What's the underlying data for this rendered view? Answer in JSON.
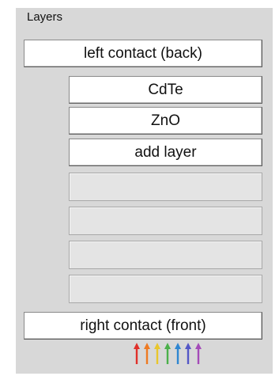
{
  "panel": {
    "title": "Layers",
    "left_contact_label": "left contact (back)",
    "layers": [
      "CdTe",
      "ZnO"
    ],
    "add_layer_label": "add layer",
    "empty_slot_count": 4,
    "right_contact_label": "right contact (front)",
    "illumination_icon": "rainbow-light-arrows-icon",
    "arrow_colors": [
      "#e0302a",
      "#ee7a22",
      "#e9c62c",
      "#4bb04a",
      "#2f86d1",
      "#5457c6",
      "#a44bb8"
    ]
  }
}
